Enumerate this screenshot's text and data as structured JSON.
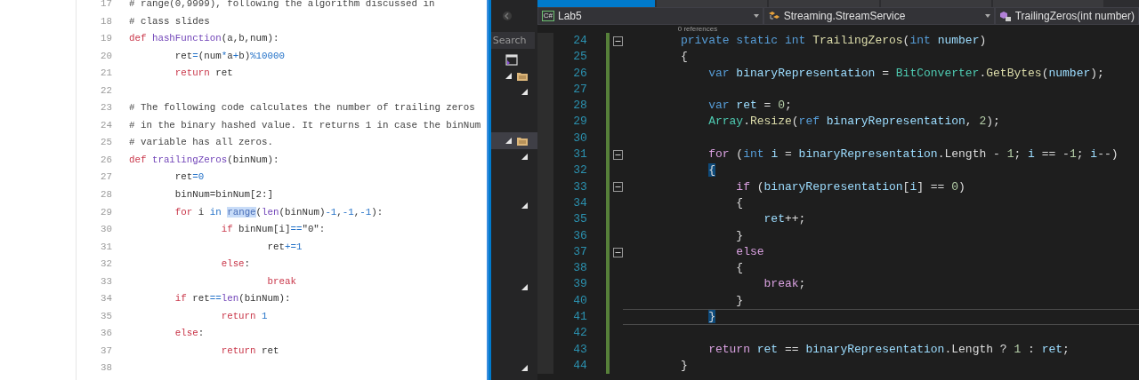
{
  "notebook": {
    "lines": [
      {
        "number": "17",
        "tokens": [
          {
            "text": "# range(0,9999), following the algorithm discussed in",
            "kind": "comment"
          }
        ]
      },
      {
        "number": "18",
        "tokens": [
          {
            "text": "# class slides",
            "kind": "comment"
          }
        ]
      },
      {
        "number": "19",
        "tokens": [
          {
            "text": "def",
            "kind": "keyword"
          },
          {
            "text": " hashFunction",
            "kind": "function"
          },
          {
            "text": "(a,b,num):",
            "kind": "plain"
          }
        ]
      },
      {
        "number": "20",
        "tokens": [
          {
            "text": "\tret",
            "kind": "plain"
          },
          {
            "text": "=",
            "kind": "operator"
          },
          {
            "text": "(num",
            "kind": "plain"
          },
          {
            "text": "*",
            "kind": "operator"
          },
          {
            "text": "a",
            "kind": "plain"
          },
          {
            "text": "+",
            "kind": "operator"
          },
          {
            "text": "b)",
            "kind": "plain"
          },
          {
            "text": "%10000",
            "kind": "number"
          }
        ]
      },
      {
        "number": "21",
        "tokens": [
          {
            "text": "\treturn",
            "kind": "keyword"
          },
          {
            "text": " ret",
            "kind": "plain"
          }
        ]
      },
      {
        "number": "22"
      },
      {
        "number": "23",
        "tokens": [
          {
            "text": "# The following code calculates the number of trailing zeros",
            "kind": "comment"
          }
        ]
      },
      {
        "number": "24",
        "tokens": [
          {
            "text": "# in the binary hashed value. It returns 1 in case the binNum",
            "kind": "comment"
          }
        ]
      },
      {
        "number": "25",
        "tokens": [
          {
            "text": "# variable has all zeros.",
            "kind": "comment"
          }
        ]
      },
      {
        "number": "26",
        "tokens": [
          {
            "text": "def",
            "kind": "keyword"
          },
          {
            "text": " trailingZeros",
            "kind": "function"
          },
          {
            "text": "(binNum):",
            "kind": "plain"
          }
        ]
      },
      {
        "number": "27",
        "tokens": [
          {
            "text": "\tret",
            "kind": "plain"
          },
          {
            "text": "=",
            "kind": "operator"
          },
          {
            "text": "0",
            "kind": "number"
          }
        ]
      },
      {
        "number": "28",
        "tokens": [
          {
            "text": "\tbinNum=binNum[2:]",
            "kind": "plain"
          }
        ]
      },
      {
        "number": "29",
        "tokens": [
          {
            "text": "\tfor",
            "kind": "keyword"
          },
          {
            "text": " i ",
            "kind": "plain"
          },
          {
            "text": "in",
            "kind": "operator"
          },
          {
            "text": " range",
            "kind": "selection"
          },
          {
            "text": "(",
            "kind": "plain"
          },
          {
            "text": "len",
            "kind": "function"
          },
          {
            "text": "(binNum)",
            "kind": "plain"
          },
          {
            "text": "-1",
            "kind": "number"
          },
          {
            "text": ",",
            "kind": "plain"
          },
          {
            "text": "-1",
            "kind": "number"
          },
          {
            "text": ",",
            "kind": "plain"
          },
          {
            "text": "-1",
            "kind": "number"
          },
          {
            "text": "):",
            "kind": "plain"
          }
        ]
      },
      {
        "number": "30",
        "tokens": [
          {
            "text": "\t\tif",
            "kind": "keyword"
          },
          {
            "text": " binNum[i]",
            "kind": "plain"
          },
          {
            "text": "==",
            "kind": "operator"
          },
          {
            "text": "\"0\":",
            "kind": "plain"
          }
        ]
      },
      {
        "number": "31",
        "tokens": [
          {
            "text": "\t\t\tret",
            "kind": "plain"
          },
          {
            "text": "+=",
            "kind": "operator"
          },
          {
            "text": "1",
            "kind": "number"
          }
        ]
      },
      {
        "number": "32",
        "tokens": [
          {
            "text": "\t\telse",
            "kind": "keyword"
          },
          {
            "text": ":",
            "kind": "plain"
          }
        ]
      },
      {
        "number": "33",
        "tokens": [
          {
            "text": "\t\t\tbreak",
            "kind": "keyword"
          }
        ]
      },
      {
        "number": "34",
        "tokens": [
          {
            "text": "\tif",
            "kind": "keyword"
          },
          {
            "text": " ret",
            "kind": "plain"
          },
          {
            "text": "==",
            "kind": "operator"
          },
          {
            "text": "len",
            "kind": "function"
          },
          {
            "text": "(binNum):",
            "kind": "plain"
          }
        ]
      },
      {
        "number": "35",
        "tokens": [
          {
            "text": "\t\treturn",
            "kind": "keyword"
          },
          {
            "text": " 1",
            "kind": "number"
          }
        ]
      },
      {
        "number": "36",
        "tokens": [
          {
            "text": "\telse",
            "kind": "keyword"
          },
          {
            "text": ":",
            "kind": "plain"
          }
        ]
      },
      {
        "number": "37",
        "tokens": [
          {
            "text": "\t\treturn",
            "kind": "keyword"
          },
          {
            "text": " ret",
            "kind": "plain"
          }
        ]
      },
      {
        "number": "38"
      }
    ]
  },
  "ide": {
    "explorer": {
      "search": {
        "placeholder": "Search"
      },
      "rows": [
        {
          "kind": "solution",
          "selected": false
        },
        {
          "kind": "project",
          "selected": false
        },
        {
          "kind": "node",
          "selected": false
        },
        {
          "kind": "blank",
          "selected": false
        },
        {
          "kind": "blank",
          "selected": false
        },
        {
          "kind": "project",
          "selected": true
        },
        {
          "kind": "node",
          "selected": false
        },
        {
          "kind": "blank",
          "selected": false
        },
        {
          "kind": "blank",
          "selected": false
        },
        {
          "kind": "node",
          "selected": false
        },
        {
          "kind": "blank",
          "selected": false
        },
        {
          "kind": "blank",
          "selected": false
        },
        {
          "kind": "blank",
          "selected": false
        },
        {
          "kind": "blank",
          "selected": false
        },
        {
          "kind": "node",
          "selected": false
        },
        {
          "kind": "blank",
          "selected": false
        },
        {
          "kind": "blank",
          "selected": false
        },
        {
          "kind": "blank",
          "selected": false
        },
        {
          "kind": "blank",
          "selected": false
        },
        {
          "kind": "node",
          "selected": false
        }
      ]
    },
    "tabs": [
      {
        "selected": true
      },
      {
        "selected": false
      },
      {
        "selected": false
      },
      {
        "selected": false
      },
      {
        "selected": false
      }
    ],
    "navigation": {
      "project_badge": "C#",
      "project": "Lab5",
      "type": "Streaming.StreamService",
      "member": "TrailingZeros(int number)"
    },
    "codelens": "0 references",
    "lines": [
      {
        "number": "24",
        "fold": true,
        "current": false,
        "tokens": [
          {
            "text": "    private",
            "kind": "keyword"
          },
          {
            "text": " static",
            "kind": "keyword"
          },
          {
            "text": " int",
            "kind": "keyword"
          },
          {
            "text": " TrailingZeros",
            "kind": "method"
          },
          {
            "text": "(",
            "kind": "plain"
          },
          {
            "text": "int",
            "kind": "keyword"
          },
          {
            "text": " number",
            "kind": "variable"
          },
          {
            "text": ")",
            "kind": "plain"
          }
        ]
      },
      {
        "number": "25",
        "fold": false,
        "current": false,
        "tokens": [
          {
            "text": "    {",
            "kind": "plain"
          }
        ]
      },
      {
        "number": "26",
        "fold": false,
        "current": false,
        "tokens": [
          {
            "text": "        var",
            "kind": "keyword"
          },
          {
            "text": " binaryRepresentation",
            "kind": "variable"
          },
          {
            "text": " = ",
            "kind": "plain"
          },
          {
            "text": "BitConverter",
            "kind": "type"
          },
          {
            "text": ".",
            "kind": "plain"
          },
          {
            "text": "GetBytes",
            "kind": "method"
          },
          {
            "text": "(",
            "kind": "plain"
          },
          {
            "text": "number",
            "kind": "variable"
          },
          {
            "text": ");",
            "kind": "plain"
          }
        ]
      },
      {
        "number": "27",
        "fold": false,
        "current": false
      },
      {
        "number": "28",
        "fold": false,
        "current": false,
        "tokens": [
          {
            "text": "        var",
            "kind": "keyword"
          },
          {
            "text": " ret",
            "kind": "variable"
          },
          {
            "text": " = ",
            "kind": "plain"
          },
          {
            "text": "0",
            "kind": "number"
          },
          {
            "text": ";",
            "kind": "plain"
          }
        ]
      },
      {
        "number": "29",
        "fold": false,
        "current": false,
        "tokens": [
          {
            "text": "        Array",
            "kind": "type"
          },
          {
            "text": ".",
            "kind": "plain"
          },
          {
            "text": "Resize",
            "kind": "method"
          },
          {
            "text": "(",
            "kind": "plain"
          },
          {
            "text": "ref",
            "kind": "keyword"
          },
          {
            "text": " binaryRepresentation",
            "kind": "variable"
          },
          {
            "text": ", ",
            "kind": "plain"
          },
          {
            "text": "2",
            "kind": "number"
          },
          {
            "text": ");",
            "kind": "plain"
          }
        ]
      },
      {
        "number": "30",
        "fold": false,
        "current": false
      },
      {
        "number": "31",
        "fold": true,
        "current": false,
        "tokens": [
          {
            "text": "        for",
            "kind": "control"
          },
          {
            "text": " (",
            "kind": "plain"
          },
          {
            "text": "int",
            "kind": "keyword"
          },
          {
            "text": " i",
            "kind": "variable"
          },
          {
            "text": " = ",
            "kind": "plain"
          },
          {
            "text": "binaryRepresentation",
            "kind": "variable"
          },
          {
            "text": ".Length - ",
            "kind": "plain"
          },
          {
            "text": "1",
            "kind": "number"
          },
          {
            "text": "; ",
            "kind": "plain"
          },
          {
            "text": "i",
            "kind": "variable"
          },
          {
            "text": " == -",
            "kind": "plain"
          },
          {
            "text": "1",
            "kind": "number"
          },
          {
            "text": "; ",
            "kind": "plain"
          },
          {
            "text": "i",
            "kind": "variable"
          },
          {
            "text": "--)",
            "kind": "plain"
          }
        ]
      },
      {
        "number": "32",
        "fold": false,
        "current": false,
        "tokens": [
          {
            "text": "        {",
            "kind": "brace-match"
          }
        ]
      },
      {
        "number": "33",
        "fold": true,
        "current": false,
        "tokens": [
          {
            "text": "            if",
            "kind": "control"
          },
          {
            "text": " (",
            "kind": "plain"
          },
          {
            "text": "binaryRepresentation",
            "kind": "variable"
          },
          {
            "text": "[",
            "kind": "plain"
          },
          {
            "text": "i",
            "kind": "variable"
          },
          {
            "text": "] == ",
            "kind": "plain"
          },
          {
            "text": "0",
            "kind": "number"
          },
          {
            "text": ")",
            "kind": "plain"
          }
        ]
      },
      {
        "number": "34",
        "fold": false,
        "current": false,
        "tokens": [
          {
            "text": "            {",
            "kind": "plain"
          }
        ]
      },
      {
        "number": "35",
        "fold": false,
        "current": false,
        "tokens": [
          {
            "text": "                ret",
            "kind": "variable"
          },
          {
            "text": "++;",
            "kind": "plain"
          }
        ]
      },
      {
        "number": "36",
        "fold": false,
        "current": false,
        "tokens": [
          {
            "text": "            }",
            "kind": "plain"
          }
        ]
      },
      {
        "number": "37",
        "fold": true,
        "current": false,
        "tokens": [
          {
            "text": "            else",
            "kind": "control"
          }
        ]
      },
      {
        "number": "38",
        "fold": false,
        "current": false,
        "tokens": [
          {
            "text": "            {",
            "kind": "plain"
          }
        ]
      },
      {
        "number": "39",
        "fold": false,
        "current": false,
        "tokens": [
          {
            "text": "                break",
            "kind": "control"
          },
          {
            "text": ";",
            "kind": "plain"
          }
        ]
      },
      {
        "number": "40",
        "fold": false,
        "current": false,
        "tokens": [
          {
            "text": "            }",
            "kind": "plain"
          }
        ]
      },
      {
        "number": "41",
        "fold": false,
        "current": true,
        "tokens": [
          {
            "text": "        }",
            "kind": "brace-match"
          }
        ]
      },
      {
        "number": "42",
        "fold": false,
        "current": false
      },
      {
        "number": "43",
        "fold": false,
        "current": false,
        "tokens": [
          {
            "text": "        return",
            "kind": "control"
          },
          {
            "text": " ret",
            "kind": "variable"
          },
          {
            "text": " == ",
            "kind": "plain"
          },
          {
            "text": "binaryRepresentation",
            "kind": "variable"
          },
          {
            "text": ".Length ? ",
            "kind": "plain"
          },
          {
            "text": "1",
            "kind": "number"
          },
          {
            "text": " : ",
            "kind": "plain"
          },
          {
            "text": "ret",
            "kind": "variable"
          },
          {
            "text": ";",
            "kind": "plain"
          }
        ]
      },
      {
        "number": "44",
        "fold": false,
        "current": false,
        "tokens": [
          {
            "text": "    }",
            "kind": "plain"
          }
        ]
      }
    ]
  }
}
